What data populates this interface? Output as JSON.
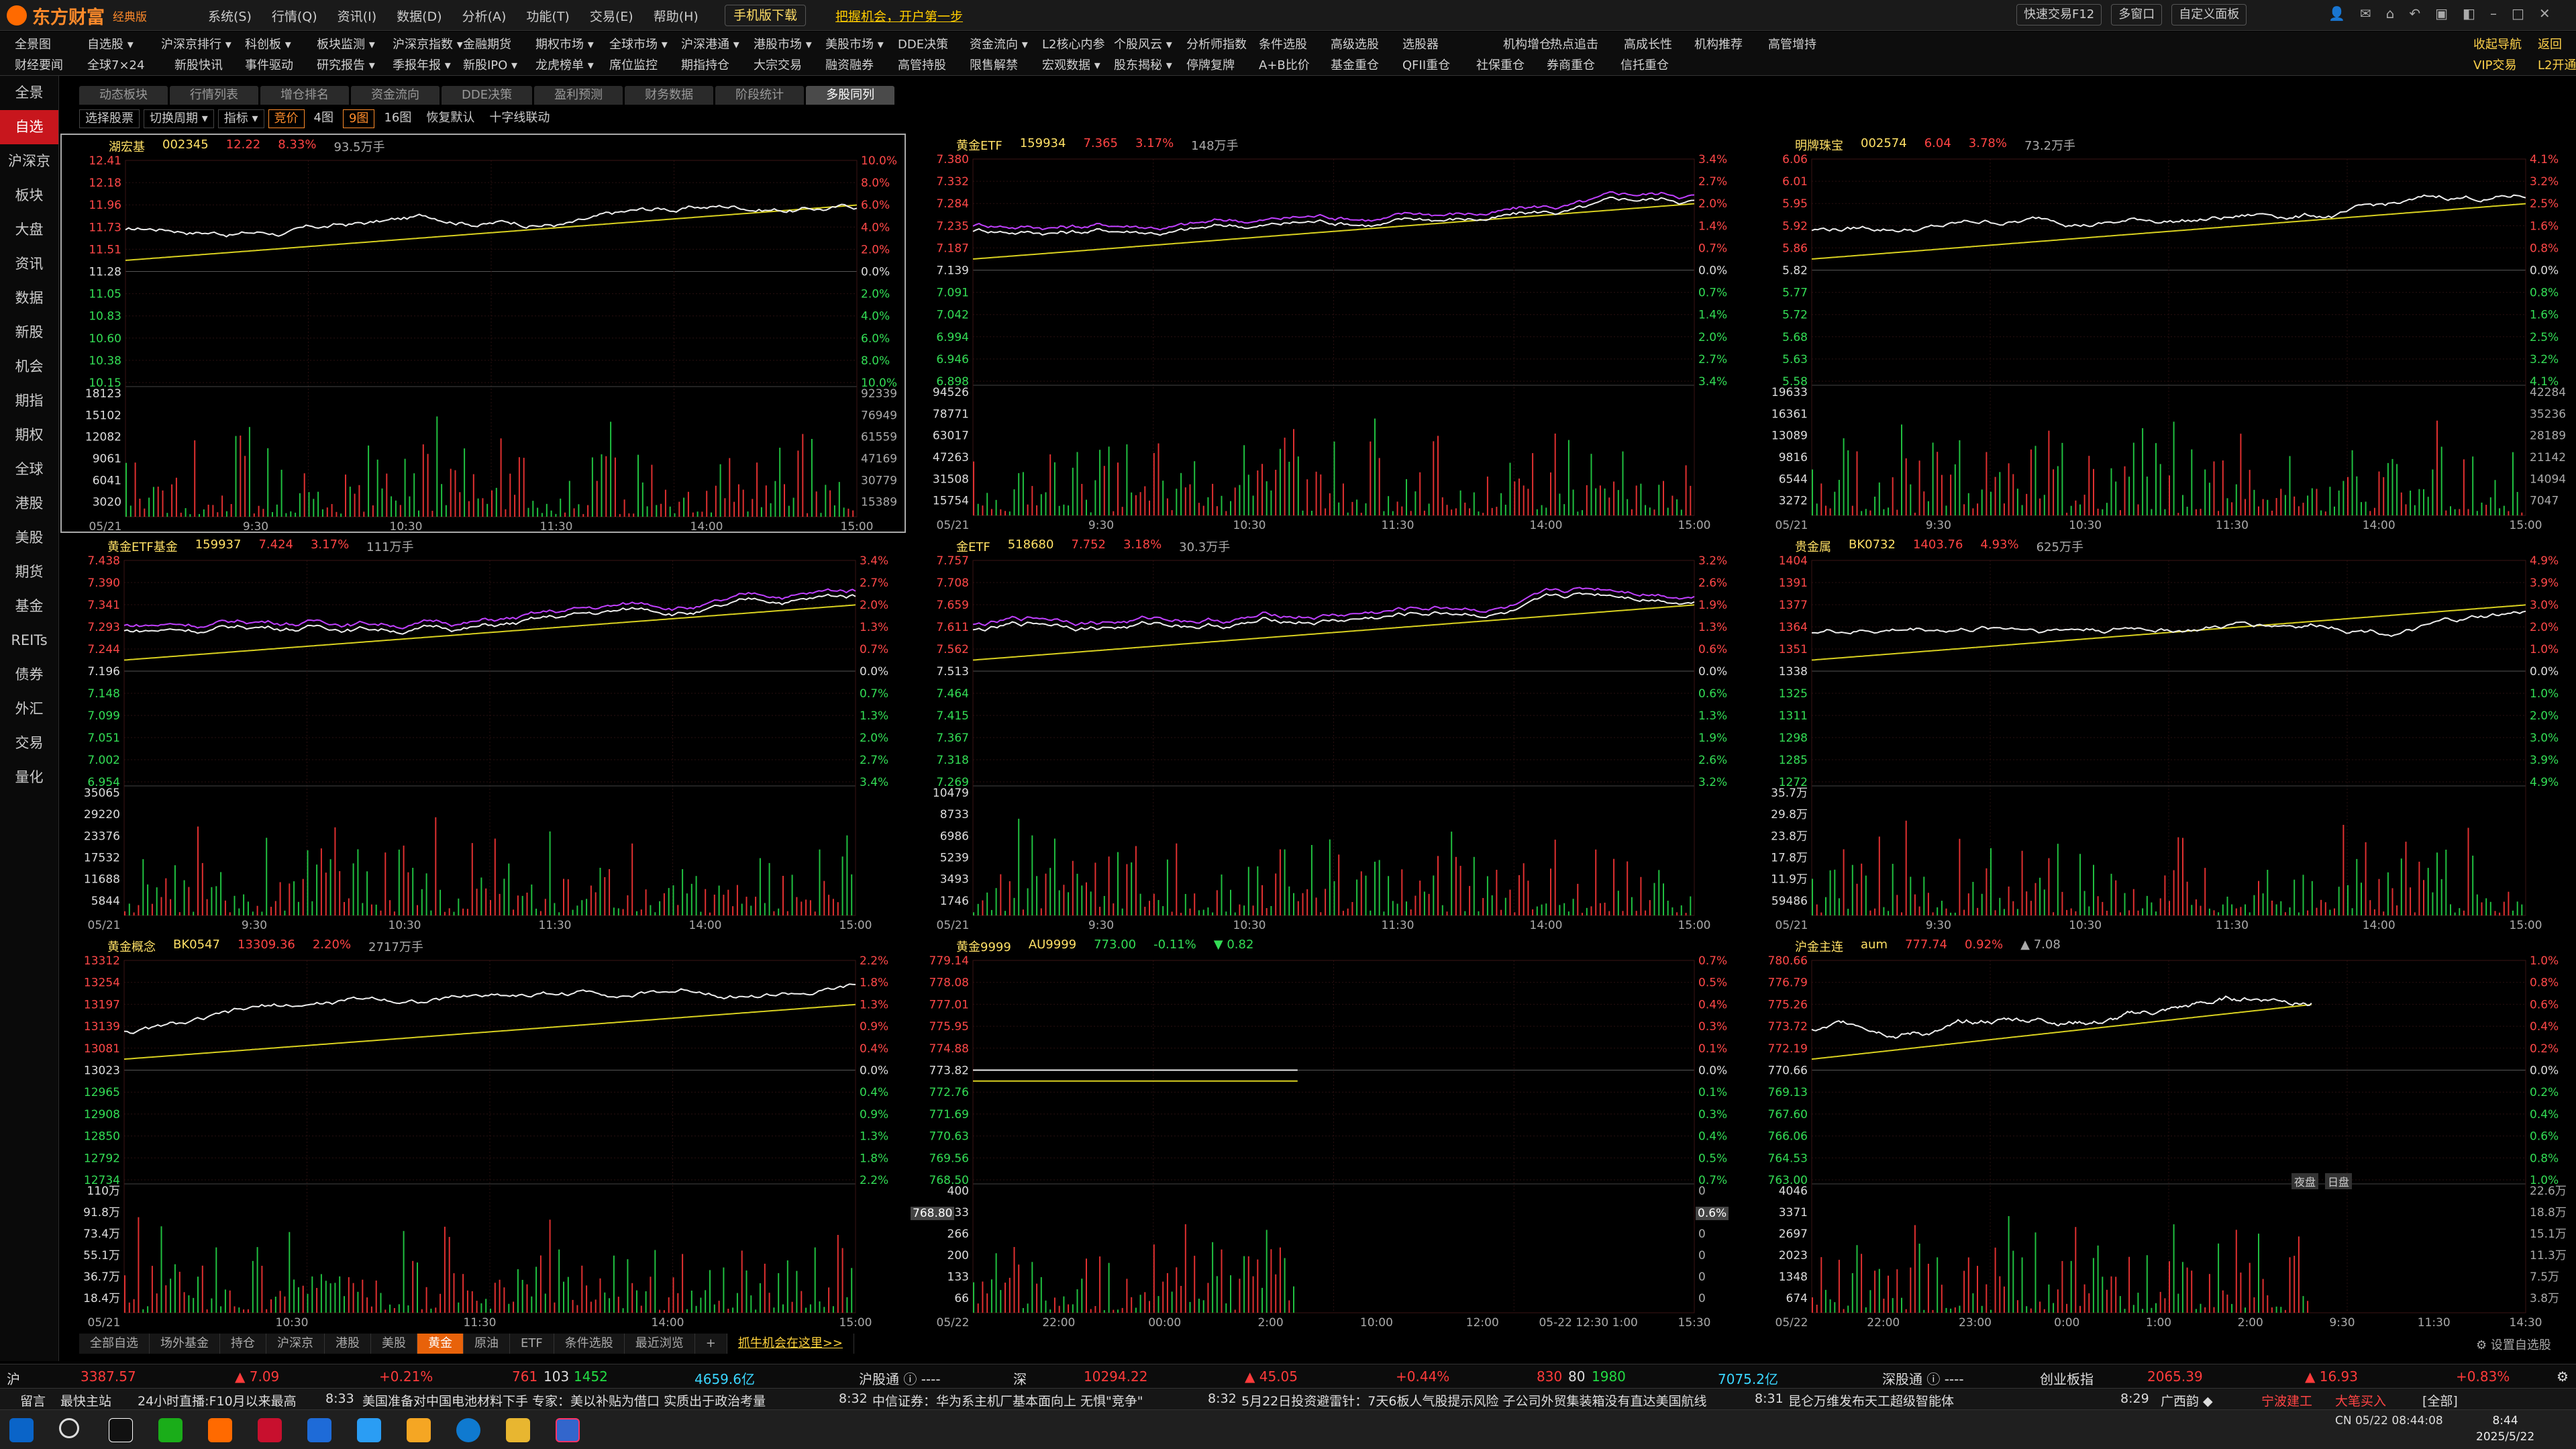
{
  "app": {
    "logo": "东方财富",
    "edition": "经典版",
    "mobile": "手机版下载",
    "promo": "把握机会，开户第一步",
    "menus": [
      "系统(S)",
      "行情(Q)",
      "资讯(I)",
      "数据(D)",
      "分析(A)",
      "功能(T)",
      "交易(E)",
      "帮助(H)"
    ],
    "right": [
      "快速交易F12",
      "多窗口",
      "自定义面板"
    ]
  },
  "nav": {
    "row1": [
      "全景图",
      "自选股 ▾",
      "沪深京排行 ▾",
      "科创板 ▾",
      "板块监测 ▾",
      "沪深京指数 ▾",
      "金融期货",
      "期权市场 ▾",
      "全球市场 ▾",
      "沪深港通 ▾",
      "港股市场 ▾",
      "美股市场 ▾",
      "DDE决策",
      "资金流向 ▾",
      "L2核心内参",
      "个股风云 ▾",
      "分析师指数",
      "条件选股",
      "高级选股",
      "选股器",
      "机构增仓",
      "热点追击",
      "高成长性",
      "机构推荐",
      "高管增持"
    ],
    "row2": [
      "财经要闻",
      "全球7×24",
      "新股快讯",
      "事件驱动",
      "研究报告 ▾",
      "季报年报 ▾",
      "新股IPO ▾",
      "龙虎榜单 ▾",
      "席位监控",
      "期指持仓",
      "大宗交易",
      "融资融券",
      "高管持股",
      "限售解禁",
      "宏观数据 ▾",
      "股东揭秘 ▾",
      "停牌复牌",
      "A+B比价",
      "基金重仓",
      "QFII重仓",
      "社保重仓",
      "券商重仓",
      "信托重仓"
    ],
    "right1": [
      "收起导航",
      "返回"
    ],
    "right2": [
      "VIP交易",
      "L2开通"
    ]
  },
  "sidebar": [
    "全景",
    "自选",
    "沪深京",
    "板块",
    "大盘",
    "资讯",
    "数据",
    "新股",
    "机会",
    "期指",
    "期权",
    "全球",
    "港股",
    "美股",
    "期货",
    "基金",
    "REITs",
    "债券",
    "外汇",
    "交易",
    "量化"
  ],
  "tabs": [
    "动态板块",
    "行情列表",
    "增仓排名",
    "资金流向",
    "DDE决策",
    "盈利预测",
    "财务数据",
    "阶段统计",
    "多股同列"
  ],
  "toolbar": [
    "选择股票",
    "切换周期 ▾",
    "指标 ▾",
    "竞价",
    "4图",
    "9图",
    "16图",
    "恢复默认",
    "十字线联动"
  ],
  "panels": [
    {
      "name": "湖宏基",
      "code": "002345",
      "price": "12.22",
      "pct": "8.33%",
      "vol": "93.5万手",
      "up": true,
      "ylabels": [
        "12.41",
        "12.18",
        "11.96",
        "11.73",
        "11.51",
        "11.28",
        "11.05",
        "10.83",
        "10.60",
        "10.38",
        "10.15"
      ],
      "pct_labels": [
        "10.0%",
        "8.0%",
        "6.0%",
        "4.0%",
        "2.0%",
        "0.0%",
        "2.0%",
        "4.0%",
        "6.0%",
        "8.0%",
        "10.0%"
      ],
      "vlabels": [
        "18123",
        "15102",
        "12082",
        "9061",
        "6041",
        "3020"
      ],
      "vright": [
        "92339",
        "76949",
        "61559",
        "47169",
        "30779",
        "15389"
      ],
      "times": [
        "05/21",
        "9:30",
        "10:30",
        "11:30",
        "14:00",
        "15:00"
      ]
    },
    {
      "name": "黄金ETF",
      "code": "159934",
      "price": "7.365",
      "pct": "3.17%",
      "vol": "148万手",
      "up": true,
      "ylabels": [
        "7.380",
        "7.332",
        "7.284",
        "7.235",
        "7.187",
        "7.139",
        "7.091",
        "7.042",
        "6.994",
        "6.946",
        "6.898"
      ],
      "pct_labels": [
        "3.4%",
        "2.7%",
        "2.0%",
        "1.4%",
        "0.7%",
        "0.0%",
        "0.7%",
        "1.4%",
        "2.0%",
        "2.7%",
        "3.4%"
      ],
      "vlabels": [
        "94526",
        "78771",
        "63017",
        "47263",
        "31508",
        "15754"
      ],
      "vright": [],
      "times": [
        "05/21",
        "9:30",
        "10:30",
        "11:30",
        "14:00",
        "15:00"
      ]
    },
    {
      "name": "明牌珠宝",
      "code": "002574",
      "price": "6.04",
      "pct": "3.78%",
      "vol": "73.2万手",
      "up": true,
      "ylabels": [
        "6.06",
        "6.01",
        "5.95",
        "5.92",
        "5.86",
        "5.82",
        "5.77",
        "5.72",
        "5.68",
        "5.63",
        "5.58"
      ],
      "pct_labels": [
        "4.1%",
        "3.2%",
        "2.5%",
        "1.6%",
        "0.8%",
        "0.0%",
        "0.8%",
        "1.6%",
        "2.5%",
        "3.2%",
        "4.1%"
      ],
      "vlabels": [
        "19633",
        "16361",
        "13089",
        "9816",
        "6544",
        "3272"
      ],
      "vright": [
        "42284",
        "35236",
        "28189",
        "21142",
        "14094",
        "7047"
      ],
      "times": [
        "05/21",
        "9:30",
        "10:30",
        "11:30",
        "14:00",
        "15:00"
      ]
    },
    {
      "name": "黄金ETF基金",
      "code": "159937",
      "price": "7.424",
      "pct": "3.17%",
      "vol": "111万手",
      "up": true,
      "ylabels": [
        "7.438",
        "7.390",
        "7.341",
        "7.293",
        "7.244",
        "7.196",
        "7.148",
        "7.099",
        "7.051",
        "7.002",
        "6.954"
      ],
      "pct_labels": [
        "3.4%",
        "2.7%",
        "2.0%",
        "1.3%",
        "0.7%",
        "0.0%",
        "0.7%",
        "1.3%",
        "2.0%",
        "2.7%",
        "3.4%"
      ],
      "vlabels": [
        "35065",
        "29220",
        "23376",
        "17532",
        "11688",
        "5844"
      ],
      "vright": [],
      "times": [
        "05/21",
        "9:30",
        "10:30",
        "11:30",
        "14:00",
        "15:00"
      ]
    },
    {
      "name": "金ETF",
      "code": "518680",
      "price": "7.752",
      "pct": "3.18%",
      "vol": "30.3万手",
      "up": true,
      "ylabels": [
        "7.757",
        "7.708",
        "7.659",
        "7.611",
        "7.562",
        "7.513",
        "7.464",
        "7.415",
        "7.367",
        "7.318",
        "7.269"
      ],
      "pct_labels": [
        "3.2%",
        "2.6%",
        "1.9%",
        "1.3%",
        "0.6%",
        "0.0%",
        "0.6%",
        "1.3%",
        "1.9%",
        "2.6%",
        "3.2%"
      ],
      "vlabels": [
        "10479",
        "8733",
        "6986",
        "5239",
        "3493",
        "1746"
      ],
      "vright": [],
      "times": [
        "05/21",
        "9:30",
        "10:30",
        "11:30",
        "14:00",
        "15:00"
      ]
    },
    {
      "name": "贵金属",
      "code": "BK0732",
      "price": "1403.76",
      "pct": "4.93%",
      "vol": "625万手",
      "up": true,
      "ylabels": [
        "1404",
        "1391",
        "1377",
        "1364",
        "1351",
        "1338",
        "1325",
        "1311",
        "1298",
        "1285",
        "1272"
      ],
      "pct_labels": [
        "4.9%",
        "3.9%",
        "3.0%",
        "2.0%",
        "1.0%",
        "0.0%",
        "1.0%",
        "2.0%",
        "3.0%",
        "3.9%",
        "4.9%"
      ],
      "vlabels": [
        "35.7万",
        "29.8万",
        "23.8万",
        "17.8万",
        "11.9万",
        "59486"
      ],
      "vright": [],
      "times": [
        "05/21",
        "9:30",
        "10:30",
        "11:30",
        "14:00",
        "15:00"
      ]
    },
    {
      "name": "黄金概念",
      "code": "BK0547",
      "price": "13309.36",
      "pct": "2.20%",
      "vol": "2717万手",
      "up": true,
      "ylabels": [
        "13312",
        "13254",
        "13197",
        "13139",
        "13081",
        "13023",
        "12965",
        "12908",
        "12850",
        "12792",
        "12734"
      ],
      "pct_labels": [
        "2.2%",
        "1.8%",
        "1.3%",
        "0.9%",
        "0.4%",
        "0.0%",
        "0.4%",
        "0.9%",
        "1.3%",
        "1.8%",
        "2.2%"
      ],
      "vlabels": [
        "110万",
        "91.8万",
        "73.4万",
        "55.1万",
        "36.7万",
        "18.4万"
      ],
      "vright": [],
      "times": [
        "05/21",
        "10:30",
        "11:30",
        "14:00",
        "15:00"
      ]
    },
    {
      "name": "黄金9999",
      "code": "AU9999",
      "price": "773.00",
      "pct": "-0.11%",
      "vol": "▼ 0.82",
      "up": false,
      "ylabels": [
        "779.14",
        "778.08",
        "777.01",
        "775.95",
        "774.88",
        "773.82",
        "772.76",
        "771.69",
        "770.63",
        "769.56",
        "768.50"
      ],
      "pct_labels": [
        "0.7%",
        "0.5%",
        "0.4%",
        "0.3%",
        "0.1%",
        "0.0%",
        "0.1%",
        "0.3%",
        "0.4%",
        "0.5%",
        "0.7%"
      ],
      "vlabels": [
        "400",
        "333",
        "266",
        "200",
        "133",
        "66"
      ],
      "vright": [
        "0",
        "0",
        "0",
        "0",
        "0",
        "0"
      ],
      "times": [
        "05/22",
        "22:00",
        "00:00",
        "2:00",
        "10:00",
        "12:00",
        "05-22 12:30 1:00",
        "15:30"
      ],
      "cursor_price": "768.80",
      "cursor_pct": "0.6%"
    },
    {
      "name": "沪金主连",
      "code": "aum",
      "price": "777.74",
      "pct": "0.92%",
      "vol": "▲ 7.08",
      "up": true,
      "ylabels": [
        "780.66",
        "776.79",
        "775.26",
        "773.72",
        "772.19",
        "770.66",
        "769.13",
        "767.60",
        "766.06",
        "764.53",
        "763.00"
      ],
      "pct_labels": [
        "1.0%",
        "0.8%",
        "0.6%",
        "0.4%",
        "0.2%",
        "0.0%",
        "0.2%",
        "0.4%",
        "0.6%",
        "0.8%",
        "1.0%"
      ],
      "vlabels": [
        "4046",
        "3371",
        "2697",
        "2023",
        "1348",
        "674"
      ],
      "vright": [
        "22.6万",
        "18.8万",
        "15.1万",
        "11.3万",
        "7.5万",
        "3.8万"
      ],
      "times": [
        "05/22",
        "22:00",
        "23:00",
        "0:00",
        "1:00",
        "2:00",
        "9:30",
        "11:30",
        "14:30"
      ],
      "session": [
        "夜盘",
        "日盘"
      ]
    }
  ],
  "bottomtabs": [
    "全部自选",
    "场外基金",
    "持仓",
    "沪深京",
    "港股",
    "美股",
    "黄金",
    "原油",
    "ETF",
    "条件选股",
    "最近浏览",
    "+",
    "抓牛机会在这里>>"
  ],
  "bottom_active": "黄金",
  "setdiy": "设置自选股",
  "index": {
    "sh": "3387.57",
    "sh_chg": "▲ 7.09",
    "sh_pct": "+0.21%",
    "sh_up": "761",
    "sh_flat": "103",
    "sh_dn": "1452",
    "sh_amt": "4659.6亿",
    "hgt": "沪股通 ⓘ ----",
    "sz_label": "深",
    "sz": "10294.22",
    "sz_chg": "▲ 45.05",
    "sz_pct": "+0.44%",
    "sz_up": "830",
    "sz_flat": "80",
    "sz_dn": "1980",
    "sz_amt": "7075.2亿",
    "sgt": "深股通 ⓘ ----",
    "cyb_label": "创业板指",
    "cyb": "2065.39",
    "cyb_chg": "▲ 16.93",
    "cyb_pct": "+0.83%"
  },
  "news": [
    "留言",
    "最快主站",
    "24小时直播:F10月以来最高",
    "8:33",
    "美国准备对中国电池材料下手 专家：美以补贴为借口 实质出于政治考量",
    "8:32",
    "中信证券：华为系主机厂基本面向上 无惧\"竞争\"",
    "8:32",
    "5月22日投资避雷针：7天6板人气股提示风险 子公司外贸集装箱没有直达美国航线",
    "8:31",
    "昆仑万维发布天工超级智能体",
    "8:29",
    "广西韵 ◆",
    "宁波建工",
    "大笔买入",
    "[全部]"
  ],
  "clock": {
    "time": "8:44",
    "date": "2025/5/22"
  },
  "status": "CN 05/22 08:44:08"
}
